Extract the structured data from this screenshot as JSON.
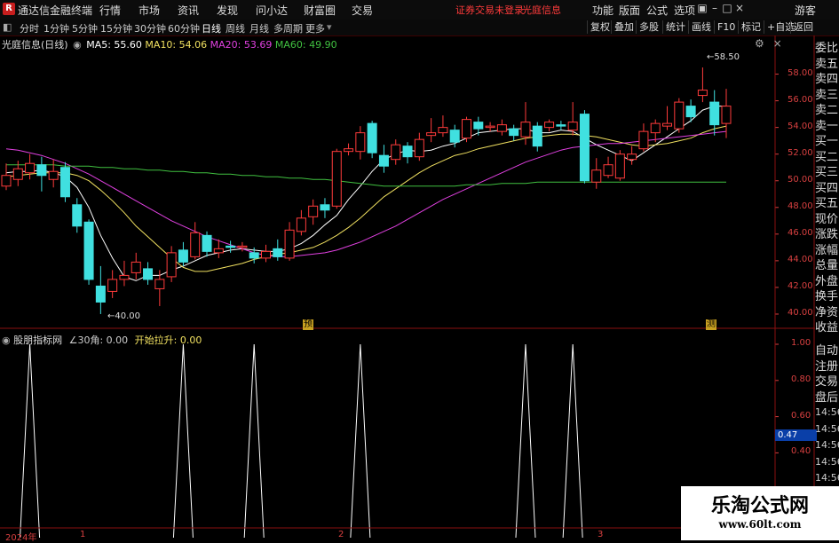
{
  "app": {
    "title": "通达信金融终端",
    "menu": [
      "行情",
      "市场",
      "资讯",
      "发现",
      "问小达",
      "财富圈",
      "交易"
    ],
    "notice": "证券交易未登录",
    "stock_name_red": "光庭信息",
    "right_menu": [
      "功能",
      "版面",
      "公式",
      "选项"
    ],
    "guest": "游客"
  },
  "toolbar": {
    "periods": [
      "分时",
      "1分钟",
      "5分钟",
      "15分钟",
      "30分钟",
      "60分钟",
      "日线",
      "周线",
      "月线",
      "多周期",
      "更多"
    ],
    "active_period": "日线",
    "right_buttons": [
      "复权",
      "叠加",
      "多股",
      "统计",
      "画线",
      "F10",
      "标记",
      "+自选",
      "返回"
    ]
  },
  "chart_header": {
    "name": "光庭信息(日线)",
    "ma5": "MA5: 55.60",
    "ma10": "MA10: 54.06",
    "ma20": "MA20: 53.69",
    "ma60": "MA60: 49.90",
    "colors": {
      "ma5": "#ffffff",
      "ma10": "#f0e060",
      "ma20": "#e040e0",
      "ma60": "#40c040",
      "up": "#ff3b3b",
      "down": "#40e0e0"
    }
  },
  "indicator_header": {
    "name": "股朋指标网",
    "p1": "∠30角: 0.00",
    "p2": "开始拉升: 0.00",
    "current_value": "0.47"
  },
  "sidebar": {
    "top": [
      "委比",
      "卖五",
      "卖四",
      "卖三",
      "卖二",
      "卖一",
      "买一",
      "买二",
      "买三",
      "买四",
      "买五",
      "现价",
      "涨跌",
      "涨幅",
      "总量",
      "外盘",
      "换手",
      "净资",
      "收益"
    ],
    "bottom": [
      "自动",
      "注册",
      "交易",
      "盘后"
    ],
    "times": [
      "14:56",
      "14:56",
      "14:56",
      "14:56",
      "14:56",
      "14:56",
      "14:56"
    ]
  },
  "x_axis": {
    "labels": [
      "2024年",
      "1",
      "2",
      "3"
    ]
  },
  "markers": {
    "left": "预",
    "right": "测"
  },
  "chart_data": {
    "type": "candlestick",
    "y_ticks": [
      40.0,
      42.0,
      44.0,
      46.0,
      48.0,
      50.0,
      52.0,
      54.0,
      56.0,
      58.0
    ],
    "ylim": [
      39.2,
      59.7
    ],
    "high_label": "58.50",
    "low_label": "40.00",
    "candles": [
      {
        "o": 49.6,
        "c": 50.4,
        "h": 51.3,
        "l": 49.3
      },
      {
        "o": 50.1,
        "c": 50.9,
        "h": 51.5,
        "l": 49.6
      },
      {
        "o": 50.6,
        "c": 51.3,
        "h": 52.0,
        "l": 50.1
      },
      {
        "o": 51.2,
        "c": 50.4,
        "h": 51.8,
        "l": 49.2
      },
      {
        "o": 50.1,
        "c": 50.7,
        "h": 51.6,
        "l": 49.5
      },
      {
        "o": 51.0,
        "c": 48.8,
        "h": 51.4,
        "l": 48.4
      },
      {
        "o": 48.2,
        "c": 46.6,
        "h": 48.7,
        "l": 46.1
      },
      {
        "o": 46.9,
        "c": 42.6,
        "h": 47.1,
        "l": 42.2
      },
      {
        "o": 42.1,
        "c": 40.9,
        "h": 43.6,
        "l": 40.0
      },
      {
        "o": 41.7,
        "c": 42.6,
        "h": 43.3,
        "l": 41.2
      },
      {
        "o": 42.6,
        "c": 42.9,
        "h": 44.0,
        "l": 42.1
      },
      {
        "o": 43.1,
        "c": 43.9,
        "h": 44.6,
        "l": 42.6
      },
      {
        "o": 43.4,
        "c": 42.6,
        "h": 43.9,
        "l": 42.2
      },
      {
        "o": 41.9,
        "c": 42.6,
        "h": 43.3,
        "l": 40.6
      },
      {
        "o": 42.8,
        "c": 44.6,
        "h": 45.1,
        "l": 42.4
      },
      {
        "o": 44.8,
        "c": 43.9,
        "h": 45.4,
        "l": 43.6
      },
      {
        "o": 44.3,
        "c": 46.1,
        "h": 46.9,
        "l": 44.1
      },
      {
        "o": 45.9,
        "c": 44.7,
        "h": 46.2,
        "l": 44.3
      },
      {
        "o": 44.6,
        "c": 44.9,
        "h": 45.6,
        "l": 44.2
      },
      {
        "o": 45.1,
        "c": 45.0,
        "h": 45.5,
        "l": 44.6
      },
      {
        "o": 45.0,
        "c": 45.1,
        "h": 45.4,
        "l": 44.7
      },
      {
        "o": 44.6,
        "c": 44.2,
        "h": 45.0,
        "l": 43.8
      },
      {
        "o": 44.2,
        "c": 44.7,
        "h": 45.2,
        "l": 43.9
      },
      {
        "o": 44.9,
        "c": 44.3,
        "h": 45.6,
        "l": 44.0
      },
      {
        "o": 44.2,
        "c": 46.3,
        "h": 46.9,
        "l": 44.0
      },
      {
        "o": 46.2,
        "c": 47.2,
        "h": 47.8,
        "l": 45.9
      },
      {
        "o": 47.3,
        "c": 48.1,
        "h": 48.6,
        "l": 46.7
      },
      {
        "o": 48.2,
        "c": 47.8,
        "h": 48.7,
        "l": 47.2
      },
      {
        "o": 48.1,
        "c": 52.2,
        "h": 52.4,
        "l": 47.9
      },
      {
        "o": 52.2,
        "c": 52.4,
        "h": 52.8,
        "l": 51.9
      },
      {
        "o": 52.2,
        "c": 53.6,
        "h": 54.1,
        "l": 51.6
      },
      {
        "o": 54.3,
        "c": 52.1,
        "h": 54.5,
        "l": 51.7
      },
      {
        "o": 51.9,
        "c": 51.1,
        "h": 52.7,
        "l": 50.6
      },
      {
        "o": 51.6,
        "c": 52.7,
        "h": 53.1,
        "l": 51.2
      },
      {
        "o": 52.6,
        "c": 51.8,
        "h": 52.9,
        "l": 51.3
      },
      {
        "o": 51.8,
        "c": 53.1,
        "h": 53.6,
        "l": 51.5
      },
      {
        "o": 53.4,
        "c": 53.6,
        "h": 54.7,
        "l": 52.9
      },
      {
        "o": 53.6,
        "c": 54.0,
        "h": 54.9,
        "l": 53.3
      },
      {
        "o": 53.8,
        "c": 52.9,
        "h": 54.2,
        "l": 52.5
      },
      {
        "o": 53.2,
        "c": 54.6,
        "h": 54.8,
        "l": 52.9
      },
      {
        "o": 54.4,
        "c": 53.9,
        "h": 54.8,
        "l": 53.4
      },
      {
        "o": 54.0,
        "c": 54.1,
        "h": 54.4,
        "l": 53.7
      },
      {
        "o": 53.7,
        "c": 54.2,
        "h": 54.6,
        "l": 53.4
      },
      {
        "o": 53.9,
        "c": 53.4,
        "h": 54.2,
        "l": 53.0
      },
      {
        "o": 53.3,
        "c": 54.4,
        "h": 55.9,
        "l": 52.7
      },
      {
        "o": 54.1,
        "c": 52.6,
        "h": 54.4,
        "l": 52.2
      },
      {
        "o": 54.0,
        "c": 54.4,
        "h": 54.6,
        "l": 53.7
      },
      {
        "o": 54.2,
        "c": 54.1,
        "h": 54.5,
        "l": 53.8
      },
      {
        "o": 53.8,
        "c": 54.4,
        "h": 55.9,
        "l": 53.4
      },
      {
        "o": 55.0,
        "c": 50.0,
        "h": 55.3,
        "l": 49.8
      },
      {
        "o": 49.9,
        "c": 50.8,
        "h": 51.7,
        "l": 49.4
      },
      {
        "o": 50.4,
        "c": 51.2,
        "h": 51.8,
        "l": 50.2
      },
      {
        "o": 50.2,
        "c": 52.0,
        "h": 52.3,
        "l": 50.0
      },
      {
        "o": 51.6,
        "c": 52.0,
        "h": 52.6,
        "l": 51.2
      },
      {
        "o": 52.4,
        "c": 53.7,
        "h": 54.3,
        "l": 52.2
      },
      {
        "o": 53.6,
        "c": 54.3,
        "h": 54.6,
        "l": 52.9
      },
      {
        "o": 54.1,
        "c": 54.3,
        "h": 55.6,
        "l": 53.8
      },
      {
        "o": 53.9,
        "c": 55.9,
        "h": 56.2,
        "l": 53.6
      },
      {
        "o": 55.6,
        "c": 54.8,
        "h": 56.1,
        "l": 54.4
      },
      {
        "o": 56.4,
        "c": 56.8,
        "h": 58.5,
        "l": 55.9
      },
      {
        "o": 55.9,
        "c": 54.2,
        "h": 56.8,
        "l": 53.4
      },
      {
        "o": 54.3,
        "c": 55.6,
        "h": 56.9,
        "l": 53.2
      }
    ],
    "ma_lines": {
      "MA5": [
        50.6,
        50.7,
        50.7,
        50.8,
        50.6,
        50.3,
        49.5,
        48.0,
        45.9,
        44.2,
        42.8,
        42.5,
        42.9,
        42.9,
        43.3,
        43.6,
        44.0,
        44.4,
        44.6,
        44.8,
        44.9,
        44.8,
        44.7,
        44.7,
        44.9,
        45.3,
        45.9,
        46.7,
        47.4,
        48.6,
        49.6,
        50.7,
        51.6,
        52.0,
        52.3,
        52.2,
        52.3,
        52.6,
        52.8,
        53.2,
        53.6,
        53.7,
        53.8,
        53.9,
        53.9,
        53.6,
        53.6,
        53.8,
        53.7,
        53.2,
        52.7,
        52.3,
        51.9,
        51.5,
        52.1,
        52.7,
        53.3,
        53.9,
        54.5,
        55.3,
        55.6,
        55.6
      ],
      "MA10": [
        50.3,
        50.4,
        50.5,
        50.6,
        50.6,
        50.6,
        50.4,
        50.0,
        49.3,
        48.5,
        47.6,
        46.6,
        45.8,
        45.0,
        44.2,
        43.5,
        43.2,
        43.2,
        43.4,
        43.6,
        43.8,
        44.1,
        44.3,
        44.5,
        44.6,
        44.8,
        45.0,
        45.4,
        45.9,
        46.5,
        47.2,
        48.0,
        48.8,
        49.4,
        50.0,
        50.6,
        51.1,
        51.5,
        51.9,
        52.1,
        52.4,
        52.6,
        52.8,
        53.0,
        53.2,
        53.3,
        53.4,
        53.5,
        53.5,
        53.4,
        53.3,
        53.1,
        52.9,
        52.7,
        52.6,
        52.7,
        52.8,
        53.0,
        53.2,
        53.6,
        53.9,
        54.1
      ],
      "MA20": [
        52.4,
        52.3,
        52.1,
        51.9,
        51.6,
        51.3,
        50.9,
        50.5,
        50.0,
        49.5,
        49.0,
        48.5,
        48.0,
        47.5,
        47.0,
        46.6,
        46.2,
        45.8,
        45.5,
        45.2,
        44.9,
        44.6,
        44.4,
        44.3,
        44.3,
        44.4,
        44.5,
        44.6,
        44.8,
        45.1,
        45.4,
        45.8,
        46.2,
        46.6,
        47.1,
        47.6,
        48.1,
        48.6,
        49.0,
        49.4,
        49.8,
        50.2,
        50.6,
        51.0,
        51.4,
        51.7,
        52.0,
        52.3,
        52.5,
        52.6,
        52.7,
        52.8,
        52.8,
        52.9,
        53.0,
        53.1,
        53.2,
        53.3,
        53.4,
        53.5,
        53.6,
        53.7
      ],
      "MA60": [
        51.2,
        51.2,
        51.2,
        51.2,
        51.2,
        51.1,
        51.1,
        51.1,
        51.0,
        51.0,
        50.9,
        50.9,
        50.8,
        50.8,
        50.7,
        50.7,
        50.6,
        50.6,
        50.5,
        50.5,
        50.4,
        50.4,
        50.3,
        50.3,
        50.2,
        50.2,
        50.1,
        50.1,
        50.0,
        49.9,
        49.8,
        49.7,
        49.6,
        49.6,
        49.6,
        49.6,
        49.6,
        49.6,
        49.6,
        49.7,
        49.7,
        49.7,
        49.8,
        49.8,
        49.8,
        49.9,
        49.9,
        49.9,
        49.9,
        49.9,
        49.9,
        49.9,
        49.9,
        49.9,
        49.9,
        49.9,
        49.9,
        49.9,
        49.9,
        49.9,
        49.9,
        49.9
      ]
    },
    "indicator": {
      "ylim": [
        0,
        1.0
      ],
      "y_ticks": [
        1.0,
        0.8,
        0.6,
        0.4
      ],
      "spike_candle_index": [
        2,
        15,
        21,
        30,
        44,
        48
      ]
    }
  }
}
